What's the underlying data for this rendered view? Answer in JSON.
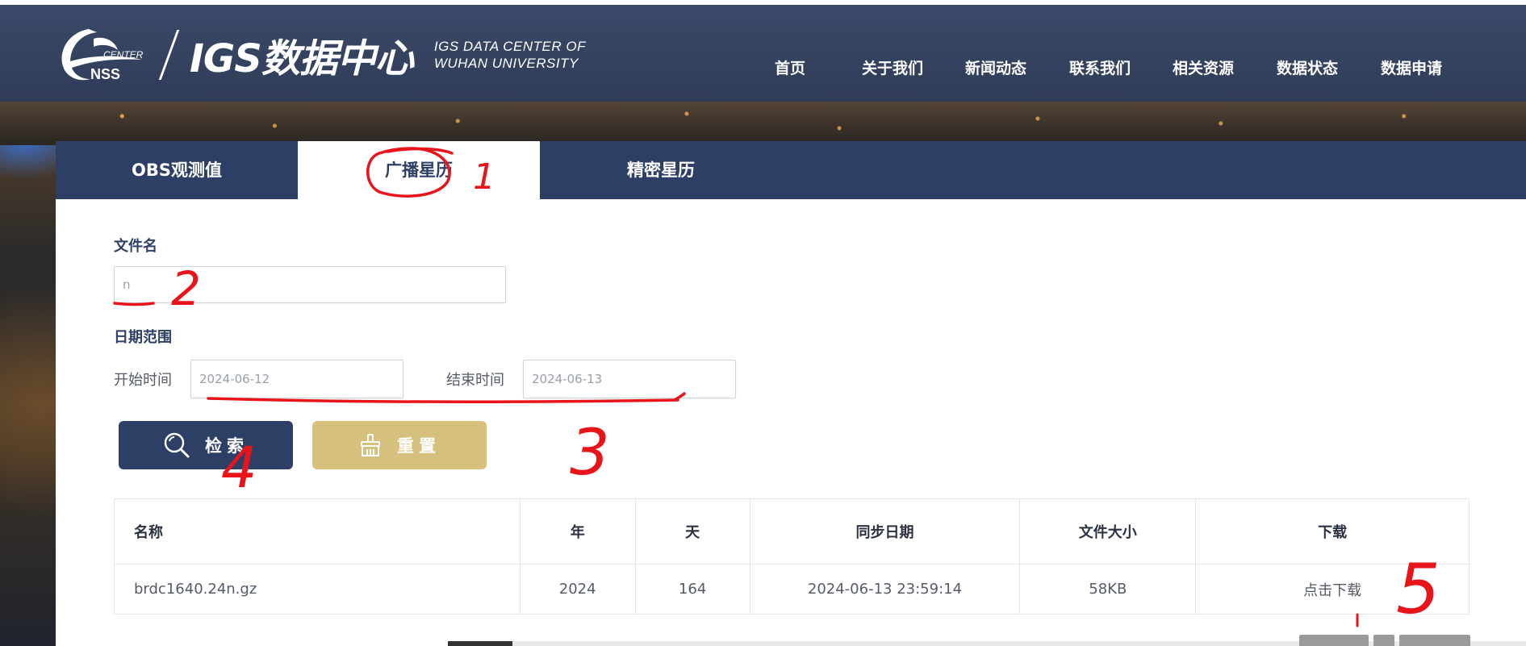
{
  "header": {
    "logo_center_text": "CENTER",
    "logo_nss_text": "NSS",
    "logo_main": "IGS数据中心",
    "logo_sub_line1": "IGS DATA CENTER OF",
    "logo_sub_line2": "WUHAN UNIVERSITY",
    "nav": [
      {
        "label": "首页"
      },
      {
        "label": "关于我们"
      },
      {
        "label": "新闻动态"
      },
      {
        "label": "联系我们"
      },
      {
        "label": "相关资源"
      },
      {
        "label": "数据状态"
      },
      {
        "label": "数据申请"
      }
    ]
  },
  "tabs": [
    {
      "label": "OBS观测值",
      "active": false
    },
    {
      "label": "广播星历",
      "active": true
    },
    {
      "label": "精密星历",
      "active": false
    }
  ],
  "form": {
    "filename_label": "文件名",
    "filename_value": "n",
    "date_range_label": "日期范围",
    "start_label": "开始时间",
    "start_value": "2024-06-12",
    "end_label": "结束时间",
    "end_value": "2024-06-13",
    "search_button": "检索",
    "reset_button": "重置"
  },
  "table": {
    "headers": [
      "名称",
      "年",
      "天",
      "同步日期",
      "文件大小",
      "下载"
    ],
    "rows": [
      [
        "brdc1640.24n.gz",
        "2024",
        "164",
        "2024-06-13 23:59:14",
        "58KB",
        "点击下载"
      ]
    ]
  },
  "colors": {
    "primary": "#2e3f66",
    "reset": "#d6c07e",
    "annotation": "#e8141a"
  },
  "annotations": [
    "1",
    "2",
    "3",
    "4",
    "5"
  ]
}
